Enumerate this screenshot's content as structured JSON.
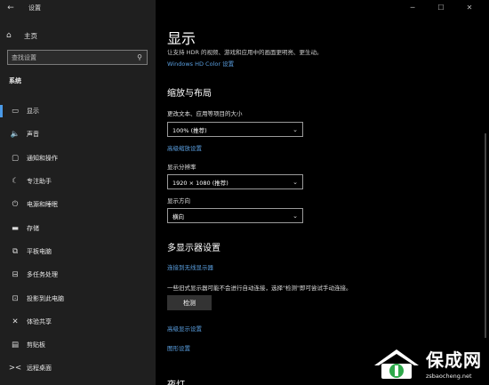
{
  "window": {
    "title": "设置",
    "back_glyph": "←",
    "controls": {
      "minimize": "─",
      "maximize": "☐",
      "close": "✕"
    }
  },
  "sidebar": {
    "home": {
      "icon": "⌂",
      "label": "主页"
    },
    "search": {
      "placeholder": "查找设置",
      "icon": "⚲"
    },
    "section": "系统",
    "items": [
      {
        "icon": "▭",
        "label": "显示",
        "active": true
      },
      {
        "icon": "🔈",
        "label": "声音"
      },
      {
        "icon": "▢",
        "label": "通知和操作"
      },
      {
        "icon": "☾",
        "label": "专注助手"
      },
      {
        "icon": "⏻",
        "label": "电源和睡眠"
      },
      {
        "icon": "▬",
        "label": "存储"
      },
      {
        "icon": "⧉",
        "label": "平板电脑"
      },
      {
        "icon": "⊟",
        "label": "多任务处理"
      },
      {
        "icon": "⊡",
        "label": "投影到此电脑"
      },
      {
        "icon": "✕",
        "label": "体验共享"
      },
      {
        "icon": "▤",
        "label": "剪贴板"
      },
      {
        "icon": "><",
        "label": "远程桌面"
      }
    ]
  },
  "main": {
    "title": "显示",
    "hdr": {
      "description": "让支持 HDR 的视频、游戏和应用中的画面更明亮、更生动。",
      "link": "Windows HD Color 设置"
    },
    "layout": {
      "heading": "缩放与布局",
      "scale_label": "更改文本、应用等项目的大小",
      "scale_value": "100% (推荐)",
      "advanced_scale_link": "高级缩放设置",
      "resolution_label": "显示分辨率",
      "resolution_value": "1920 × 1080 (推荐)",
      "orientation_label": "显示方向",
      "orientation_value": "横向"
    },
    "multi": {
      "heading": "多显示器设置",
      "wireless_link": "连接到无线显示器",
      "note": "一些旧式显示器可能不会进行自动连接，选择\"检测\"即可尝试手动连接。",
      "detect_button": "检测",
      "advanced_display_link": "高级显示设置",
      "graphics_link": "图形设置"
    },
    "next_heading": "夜灯"
  },
  "watermark": {
    "brand": "保成网",
    "domain": "zsbaocheng.net"
  },
  "colors": {
    "accent": "#4a9ae8",
    "link": "#5a9fe0",
    "sidebar_bg": "#1f1f1f",
    "main_bg": "#000000"
  }
}
